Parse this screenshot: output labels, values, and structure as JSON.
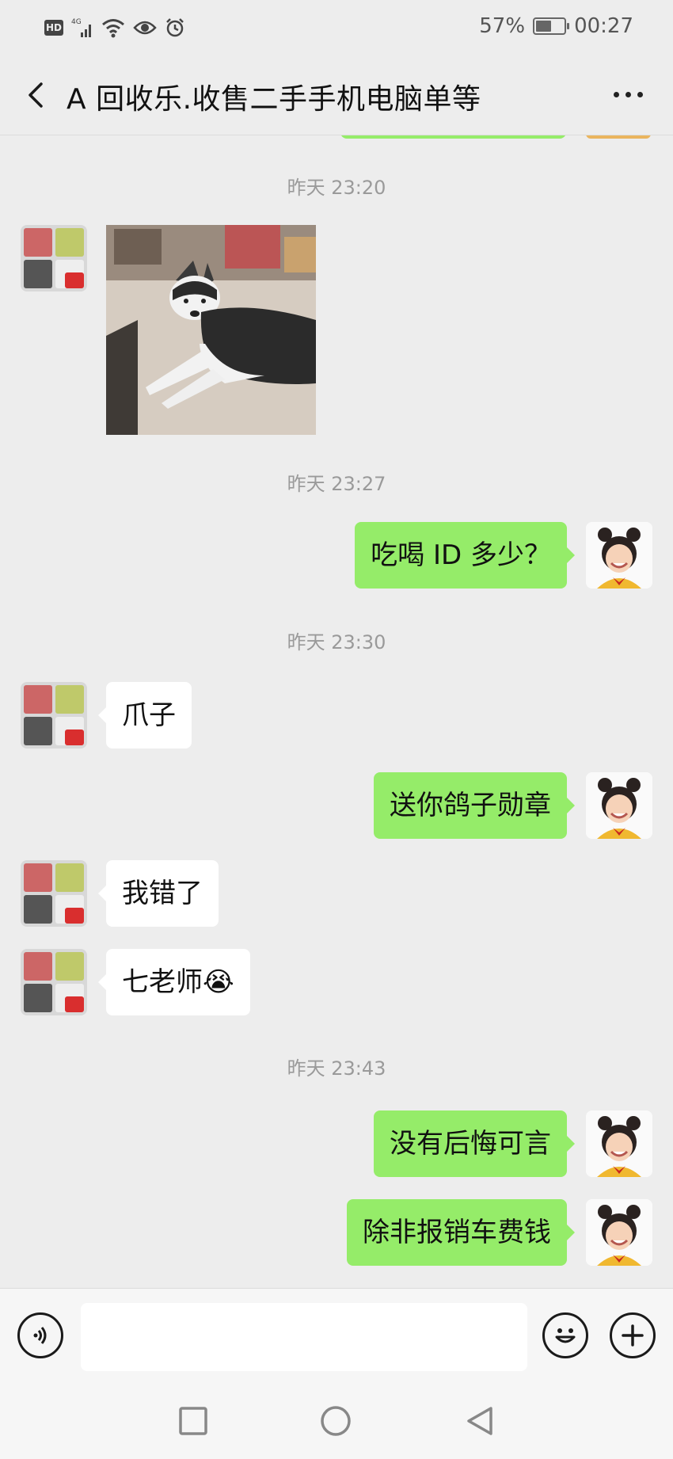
{
  "status_bar": {
    "hd": "HD",
    "network": "4G",
    "battery_percent": "57%",
    "battery_level": 0.57,
    "time": "00:27"
  },
  "header": {
    "title": "A  回收乐.收售二手手机电脑单等"
  },
  "messages": [
    {
      "type": "time",
      "text": "昨天 23:20"
    },
    {
      "type": "image",
      "from": "other"
    },
    {
      "type": "time",
      "text": "昨天 23:27"
    },
    {
      "type": "text",
      "from": "self",
      "text": "吃喝 ID 多少？"
    },
    {
      "type": "time",
      "text": "昨天 23:30"
    },
    {
      "type": "text",
      "from": "other",
      "text": "爪子"
    },
    {
      "type": "text",
      "from": "self",
      "text": "送你鸽子勋章"
    },
    {
      "type": "text",
      "from": "other",
      "text": "我错了"
    },
    {
      "type": "text",
      "from": "other",
      "text": "七老师😭"
    },
    {
      "type": "time",
      "text": "昨天 23:43"
    },
    {
      "type": "text",
      "from": "self",
      "text": "没有后悔可言"
    },
    {
      "type": "text",
      "from": "self",
      "text": "除非报销车费钱"
    }
  ],
  "input": {
    "placeholder": "",
    "value": ""
  },
  "icons": {
    "voice": "voice-icon",
    "emoji": "emoji-icon",
    "add": "add-icon",
    "back": "back-icon",
    "more": "more-icon"
  },
  "colors": {
    "background": "#ededed",
    "outgoing_bubble": "#95ec69",
    "incoming_bubble": "#ffffff",
    "timestamp": "#9a9a9a"
  }
}
